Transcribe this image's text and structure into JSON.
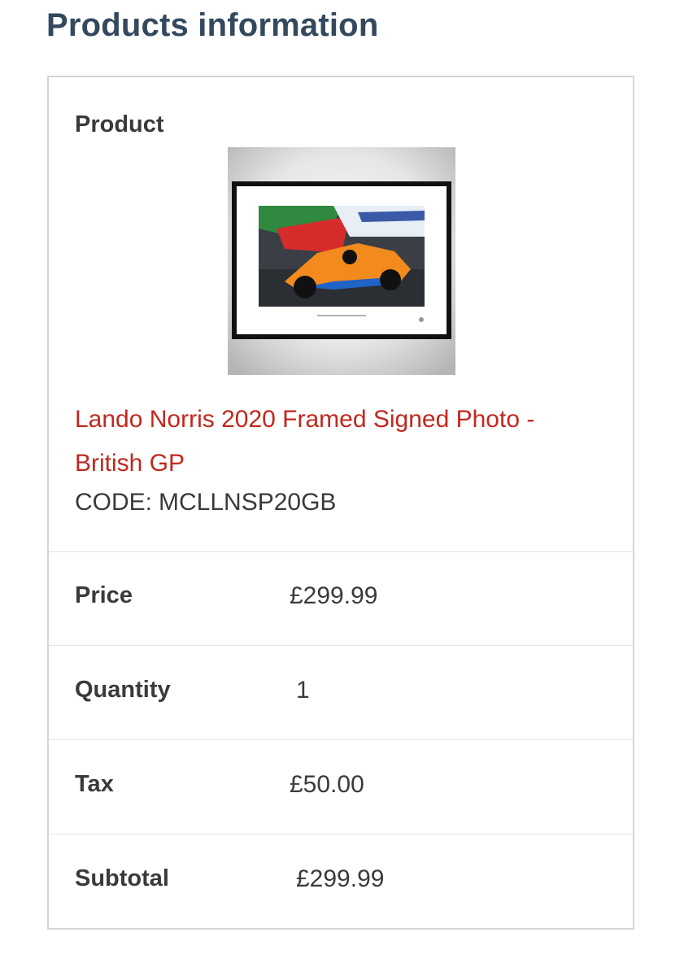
{
  "page": {
    "title": "Products information"
  },
  "product": {
    "heading": "Product",
    "image_alt": "Lando Norris 2020 Framed Signed Photo - British GP",
    "name": "Lando Norris 2020 Framed Signed Photo - British GP",
    "code_label": "CODE:",
    "code_value": "MCLLNSP20GB"
  },
  "rows": [
    {
      "label": "Price",
      "value": "£299.99"
    },
    {
      "label": "Quantity",
      "value": "1"
    },
    {
      "label": "Tax",
      "value": "£50.00"
    },
    {
      "label": "Subtotal",
      "value": "£299.99"
    }
  ],
  "colors": {
    "title": "#34495e",
    "link": "#c0281f",
    "text": "#3a3a3a",
    "border": "#d6d6d6"
  }
}
